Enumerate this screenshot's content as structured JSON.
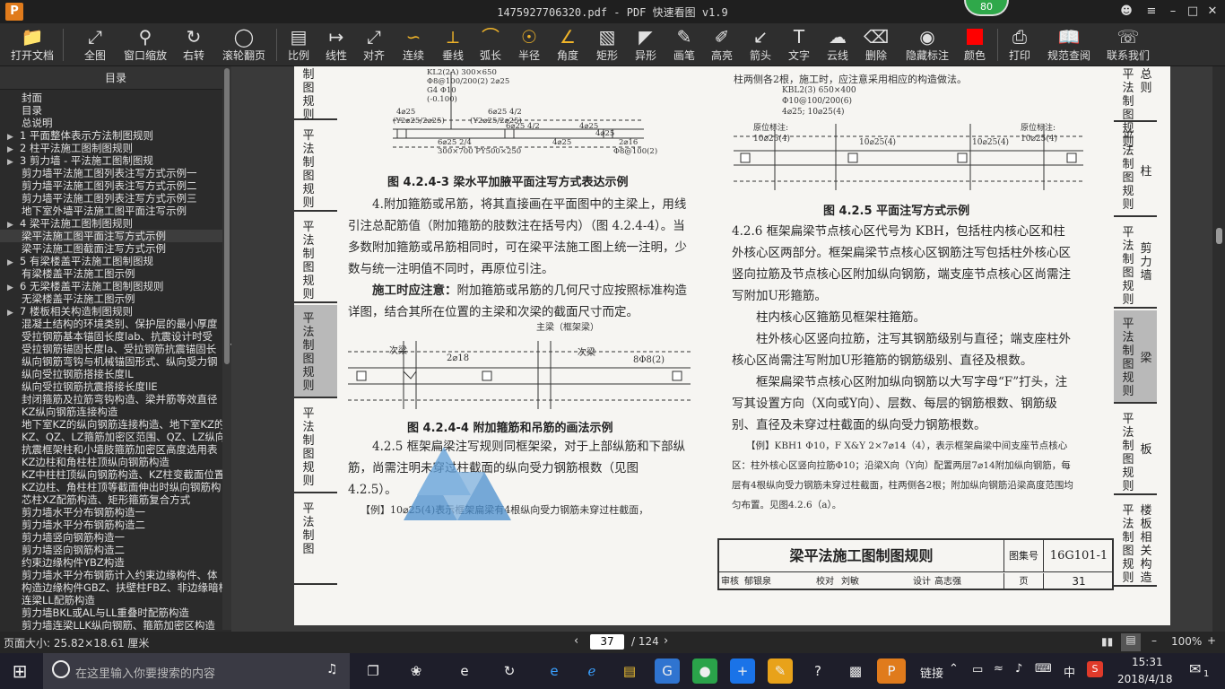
{
  "window": {
    "title": "1475927706320.pdf - PDF 快速看图 v1.9",
    "notify_count": "80"
  },
  "toolbar": {
    "items": [
      {
        "label": "打开文档",
        "icon": "folder-icon"
      },
      {
        "label": "全图",
        "icon": "fit-icon"
      },
      {
        "label": "窗口缩放",
        "icon": "zoom-icon"
      },
      {
        "label": "右转",
        "icon": "rotate-icon"
      },
      {
        "label": "滚轮翻页",
        "icon": "mouse-icon"
      },
      {
        "label": "比例",
        "icon": "scale-icon"
      },
      {
        "label": "线性",
        "icon": "linear-icon"
      },
      {
        "label": "对齐",
        "icon": "align-icon"
      },
      {
        "label": "连续",
        "icon": "continuous-icon"
      },
      {
        "label": "垂线",
        "icon": "perpendicular-icon"
      },
      {
        "label": "弧长",
        "icon": "arc-icon"
      },
      {
        "label": "半径",
        "icon": "radius-icon"
      },
      {
        "label": "角度",
        "icon": "angle-icon"
      },
      {
        "label": "矩形",
        "icon": "rect-icon"
      },
      {
        "label": "异形",
        "icon": "shape-icon"
      },
      {
        "label": "画笔",
        "icon": "pen-icon"
      },
      {
        "label": "高亮",
        "icon": "highlight-icon"
      },
      {
        "label": "箭头",
        "icon": "arrow-icon"
      },
      {
        "label": "文字",
        "icon": "text-icon"
      },
      {
        "label": "云线",
        "icon": "cloud-icon"
      },
      {
        "label": "删除",
        "icon": "eraser-icon"
      },
      {
        "label": "隐藏标注",
        "icon": "eye-icon"
      },
      {
        "label": "颜色",
        "icon": "color-icon"
      },
      {
        "label": "打印",
        "icon": "print-icon"
      },
      {
        "label": "规范查阅",
        "icon": "book-icon"
      },
      {
        "label": "联系我们",
        "icon": "contact-icon"
      }
    ],
    "color_swatch": "#ff0000"
  },
  "toc": {
    "title": "目录",
    "items": [
      {
        "text": "封面",
        "type": "leaf"
      },
      {
        "text": "目录",
        "type": "leaf"
      },
      {
        "text": "总说明",
        "type": "leaf"
      },
      {
        "text": "1 平面整体表示方法制图规则",
        "type": "sec"
      },
      {
        "text": "2 柱平法施工图制图规则",
        "type": "sec"
      },
      {
        "text": "3 剪力墙 - 平法施工图制图规",
        "type": "sec"
      },
      {
        "text": "剪力墙平法施工图列表注写方式示例一",
        "type": "leaf"
      },
      {
        "text": "剪力墙平法施工图列表注写方式示例二",
        "type": "leaf"
      },
      {
        "text": "剪力墙平法施工图列表注写方式示例三",
        "type": "leaf"
      },
      {
        "text": "地下室外墙平法施工图平面注写示例",
        "type": "leaf"
      },
      {
        "text": "4 梁平法施工图制图规则",
        "type": "sec"
      },
      {
        "text": "梁平法施工图平面注写方式示例",
        "type": "leaf",
        "active": true
      },
      {
        "text": "梁平法施工图截面注写方式示例",
        "type": "leaf"
      },
      {
        "text": "5 有梁楼盖平法施工图制图规",
        "type": "sec"
      },
      {
        "text": "有梁楼盖平法施工图示例",
        "type": "leaf"
      },
      {
        "text": "6 无梁楼盖平法施工图制图规则",
        "type": "sec"
      },
      {
        "text": "无梁楼盖平法施工图示例",
        "type": "leaf"
      },
      {
        "text": "7 楼板相关构造制图规则",
        "type": "sec"
      },
      {
        "text": "混凝土结构的环境类别、保护层的最小厚度",
        "type": "leaf"
      },
      {
        "text": "受拉钢筋基本锚固长度lab、抗震设计时受",
        "type": "leaf"
      },
      {
        "text": "受拉钢筋锚固长度la、受拉钢筋抗震锚固长",
        "type": "leaf"
      },
      {
        "text": "纵向钢筋弯钩与机械锚固形式、纵向受力钢",
        "type": "leaf"
      },
      {
        "text": "纵向受拉钢筋搭接长度lL",
        "type": "leaf"
      },
      {
        "text": "纵向受拉钢筋抗震搭接长度llE",
        "type": "leaf"
      },
      {
        "text": "封闭箍筋及拉筋弯钩构造、梁并筋等效直径",
        "type": "leaf"
      },
      {
        "text": "KZ纵向钢筋连接构造",
        "type": "leaf"
      },
      {
        "text": "地下室KZ的纵向钢筋连接构造、地下室KZ的",
        "type": "leaf"
      },
      {
        "text": "KZ、QZ、LZ箍筋加密区范围、QZ、LZ纵向钢",
        "type": "leaf"
      },
      {
        "text": "抗震框架柱和小墙肢箍筋加密区高度选用表",
        "type": "leaf"
      },
      {
        "text": "KZ边柱和角柱柱顶纵向钢筋构造",
        "type": "leaf"
      },
      {
        "text": "KZ中柱柱顶纵向钢筋构造、KZ柱变截面位置",
        "type": "leaf"
      },
      {
        "text": "KZ边柱、角柱柱顶等截面伸出时纵向钢筋构",
        "type": "leaf"
      },
      {
        "text": "芯柱XZ配筋构造、矩形箍筋复合方式",
        "type": "leaf"
      },
      {
        "text": "剪力墙水平分布钢筋构造一",
        "type": "leaf"
      },
      {
        "text": "剪力墙水平分布钢筋构造二",
        "type": "leaf"
      },
      {
        "text": "剪力墙竖向钢筋构造一",
        "type": "leaf"
      },
      {
        "text": "剪力墙竖向钢筋构造二",
        "type": "leaf"
      },
      {
        "text": "约束边缘构件YBZ构造",
        "type": "leaf"
      },
      {
        "text": "剪力墙水平分布钢筋计入约束边缘构件、体",
        "type": "leaf"
      },
      {
        "text": "构造边缘构件GBZ、扶壁柱FBZ、非边缘暗柱",
        "type": "leaf"
      },
      {
        "text": "连梁LL配筋构造",
        "type": "leaf"
      },
      {
        "text": "剪力墙BKL或AL与LL重叠时配筋构造",
        "type": "leaf"
      },
      {
        "text": "剪力墙连梁LLK纵向钢筋、箍筋加密区构造",
        "type": "leaf"
      }
    ]
  },
  "doc": {
    "fig_423_caption": "图 4.2.4-3  梁水平加腋平面注写方式表达示例",
    "fig_423_labels": [
      "KL2(2A) 300×650",
      "Φ8@100/200(2) 2⌀25",
      "G4 Φ10",
      "(-0.100)",
      "4⌀25",
      "(Y2⌀25/2⌀25)",
      "6⌀25 4/2",
      "(Y2⌀25/2⌀25)",
      "6⌀25 4/2",
      "4⌀25",
      "4⌀25",
      "6⌀25 2/4",
      "300×700 PY500×250",
      "4⌀25",
      "2⌀16",
      "Φ8@100(2)"
    ],
    "para_1": "4.附加箍筋或吊筋，将其直接画在平面图中的主梁上，用线引注总配筋值（附加箍筋的肢数注在括号内）（图 4.2.4-4）。当多数附加箍筋或吊筋相同时，可在梁平法施工图上统一注明，少数与统一注明值不同时，再原位引注。",
    "para_2_title": "施工时应注意：",
    "para_2": "附加箍筋或吊筋的几何尺寸应按照标准构造详图，结合其所在位置的主梁和次梁的截面尺寸而定。",
    "fig_424_labels": [
      "主梁（框架梁）",
      "次梁",
      "2⌀18",
      "次梁",
      "8Φ8(2)"
    ],
    "fig_424_caption": "图 4.2.4-4  附加箍筋和吊筋的画法示例",
    "para_3": "4.2.5  框架扁梁注写规则同框架梁，对于上部纵筋和下部纵筋，尚需注明未穿过柱截面的纵向受力钢筋根数（见图 4.2.5）。",
    "example_1": "【例】10⌀25(4)表示框架扁梁有4根纵向受力钢筋未穿过柱截面，",
    "right_top": "柱两侧各2根，施工时，应注意采用相应的构造做法。",
    "fig_425_labels": [
      "KBL2(3)  650×400",
      "Φ10@100/200(6)",
      "4⌀25; 10⌀25(4)",
      "原位标注:",
      "10⌀25(4)",
      "10⌀25(4)",
      "10⌀25(4)",
      "原位标注:",
      "10⌀25(4)"
    ],
    "fig_425_caption": "图 4.2.5  平面注写方式示例",
    "para_4": "4.2.6  框架扁梁节点核心区代号为 KBH，包括柱内核心区和柱外核心区两部分。框架扁梁节点核心区钢筋注写包括柱外核心区竖向拉筋及节点核心区附加纵向钢筋，端支座节点核心区尚需注写附加U形箍筋。",
    "para_5": "柱内核心区箍筋见框架柱箍筋。",
    "para_6": "柱外核心区竖向拉筋，注写其钢筋级别与直径；端支座柱外核心区尚需注写附加U形箍筋的钢筋级别、直径及根数。",
    "para_7": "框架扁梁节点核心区附加纵向钢筋以大写字母“F”打头，注写其设置方向（X向或Y向）、层数、每层的钢筋根数、钢筋级别、直径及未穿过柱截面的纵向受力钢筋根数。",
    "example_2": "【例】KBH1 Φ10，F X&Y 2×7⌀14（4），表示框架扁梁中间支座节点核心区：柱外核心区竖向拉筋Φ10；沿梁X向（Y向）配置两层7⌀14附加纵向钢筋，每层有4根纵向受力钢筋未穿过柱截面，柱两侧各2根；附加纵向钢筋沿梁高度范围均匀布置。见图4.2.6（a）。",
    "titleblock": {
      "title": "梁平法施工图制图规则",
      "atlas_label": "图集号",
      "atlas_no": "16G101-1",
      "page_label": "页",
      "page_no": "31",
      "row": [
        "审核",
        "郁银泉",
        "校对",
        "刘敏",
        "设计",
        "高志强"
      ]
    },
    "tabs": [
      {
        "v1": "制图规则",
        "v2": ""
      },
      {
        "v1": "平法制图规则",
        "v2": ""
      },
      {
        "v1": "平法制图规则",
        "v2": ""
      },
      {
        "v1": "平法制图规则",
        "v2": ""
      },
      {
        "v1": "平法制图规则",
        "v2": ""
      },
      {
        "v1": "平法制图",
        "v2": ""
      }
    ],
    "right_tabs": [
      {
        "v1": "平法制图规则",
        "v2": "总则"
      },
      {
        "v1": "平法制图规则",
        "v2": "柱"
      },
      {
        "v1": "平法制图规则",
        "v2": "剪力墙"
      },
      {
        "v1": "平法制图规则",
        "v2": "梁",
        "sel": true
      },
      {
        "v1": "平法制图规则",
        "v2": "板"
      },
      {
        "v1": "平法制图规则",
        "v2": "楼板相关构造"
      }
    ]
  },
  "status": {
    "page_size": "页面大小: 25.82×18.61 厘米",
    "current_page": "37",
    "total_pages": "/ 124",
    "zoom": "100%"
  },
  "taskbar": {
    "search_placeholder": "在这里输入你要搜索的内容",
    "link_label": "链接",
    "ime": "中",
    "time": "15:31",
    "date": "2018/4/18",
    "notifications": "1"
  }
}
